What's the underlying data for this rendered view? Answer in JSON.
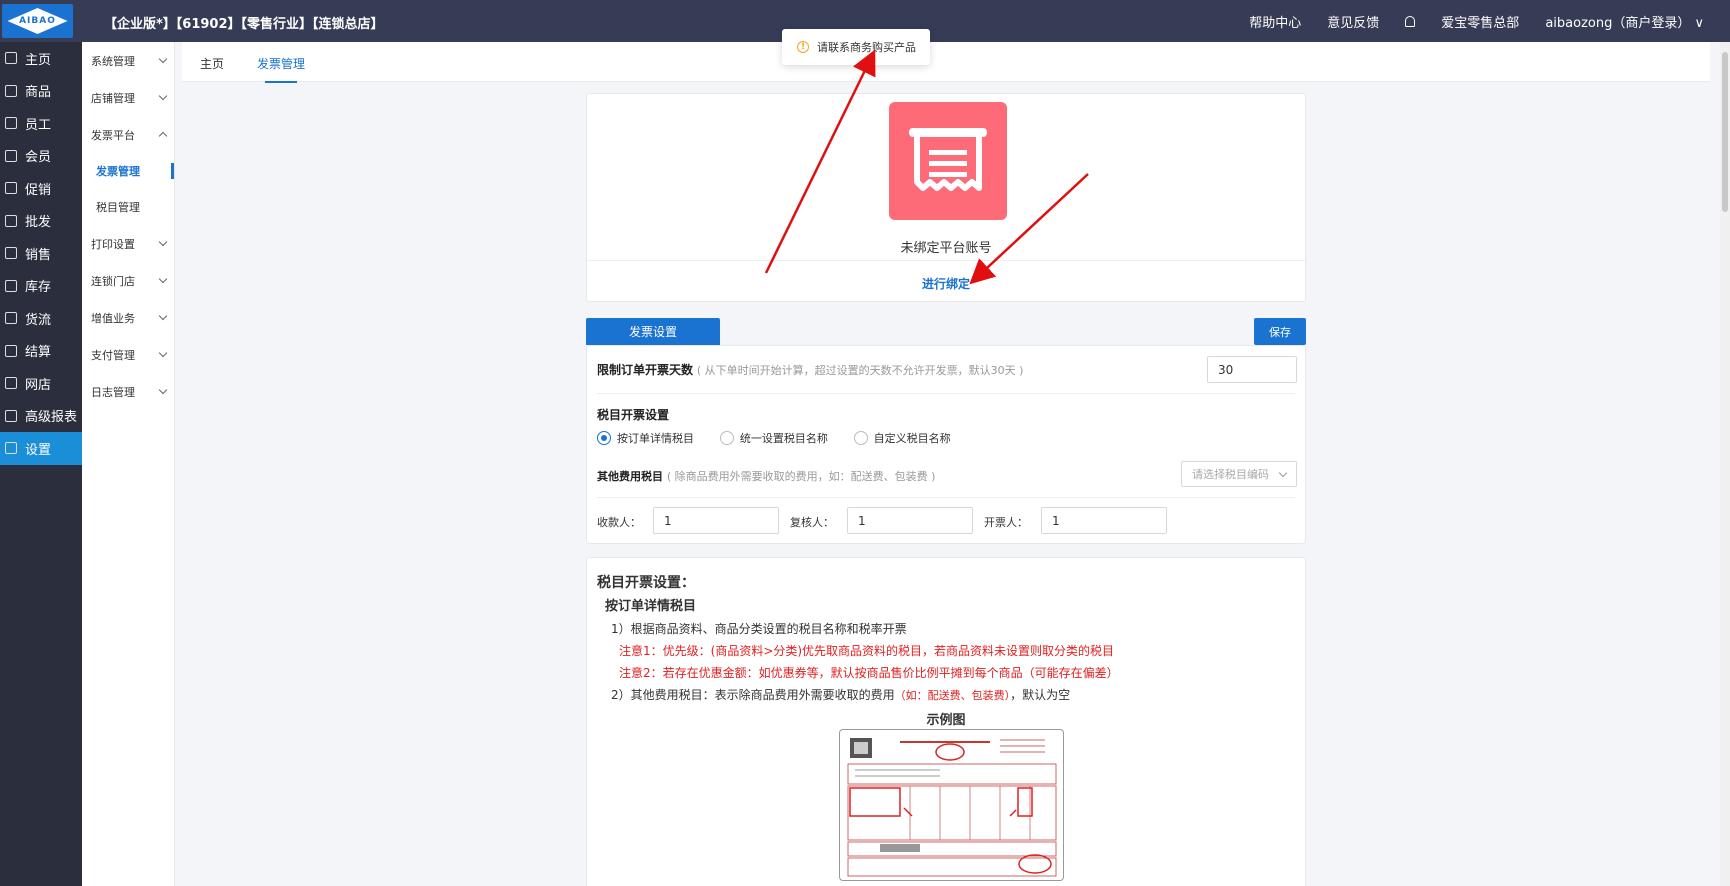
{
  "topbar": {
    "logo_text": "AIBAO",
    "tags": "【企业版*】【61902】【零售行业】【连锁总店】",
    "help": "帮助中心",
    "feedback": "意见反馈",
    "store": "爱宝零售总部",
    "user": "aibaozong（商户登录）"
  },
  "nav": {
    "items": [
      {
        "label": "主页",
        "icon": "home-icon"
      },
      {
        "label": "商品",
        "icon": "goods-icon"
      },
      {
        "label": "员工",
        "icon": "staff-icon"
      },
      {
        "label": "会员",
        "icon": "member-icon"
      },
      {
        "label": "促销",
        "icon": "promo-icon"
      },
      {
        "label": "批发",
        "icon": "wholesale-icon"
      },
      {
        "label": "销售",
        "icon": "sales-icon"
      },
      {
        "label": "库存",
        "icon": "stock-icon"
      },
      {
        "label": "货流",
        "icon": "logistics-icon"
      },
      {
        "label": "结算",
        "icon": "settle-icon"
      },
      {
        "label": "网店",
        "icon": "shop-icon"
      },
      {
        "label": "高级报表",
        "icon": "report-icon"
      },
      {
        "label": "设置",
        "icon": "settings-icon"
      }
    ]
  },
  "subnav": {
    "system": "系统管理",
    "store": "店铺管理",
    "invoice_platform": "发票平台",
    "invoice_manage": "发票管理",
    "tax_manage": "税目管理",
    "print": "打印设置",
    "chain": "连锁门店",
    "value_added": "增值业务",
    "payment": "支付管理",
    "log": "日志管理"
  },
  "tabs": {
    "home": "主页",
    "invoice": "发票管理"
  },
  "toast": {
    "text": "请联系商务购买产品"
  },
  "bind": {
    "status": "未绑定平台账号",
    "action": "进行绑定"
  },
  "settings": {
    "tab": "发票设置",
    "save": "保存",
    "limit_label": "限制订单开票天数",
    "limit_hint": "( 从下单时间开始计算，超过设置的天数不允许开发票，默认30天 )",
    "limit_value": "30",
    "tax_setting_label": "税目开票设置",
    "radio1": "按订单详情税目",
    "radio2": "统一设置税目名称",
    "radio3": "自定义税目名称",
    "other_fee_label": "其他费用税目",
    "other_fee_hint": "( 除商品费用外需要收取的费用，如：配送费、包装费 )",
    "select_placeholder": "请选择税目编码",
    "payee_label": "收款人：",
    "payee_value": "1",
    "reviewer_label": "复核人：",
    "reviewer_value": "1",
    "drawer_label": "开票人：",
    "drawer_value": "1"
  },
  "help": {
    "title": "税目开票设置：",
    "subtitle": "按订单详情税目",
    "line1": "1）根据商品资料、商品分类设置的税目名称和税率开票",
    "note1": "注意1：优先级：(商品资料>分类)优先取商品资料的税目，若商品资料未设置则取分类的税目",
    "note2": "注意2：若存在优惠金额：如优惠券等，默认按商品售价比例平摊到每个商品（可能存在偏差）",
    "line2_a": "2）其他费用税目：表示除商品费用外需要收取的费用",
    "line2_b": "（如：配送费、包装费）",
    "line2_c": "，默认为空",
    "example": "示例图"
  }
}
